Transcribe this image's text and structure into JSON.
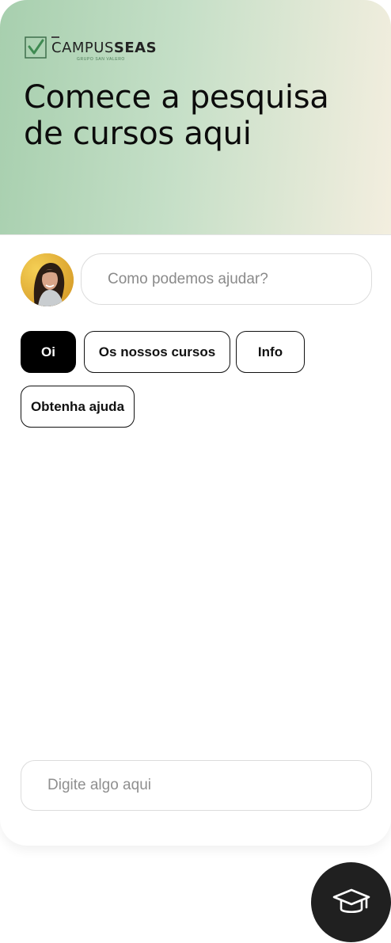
{
  "header": {
    "brand": {
      "light": "CAMPUS",
      "bold": "SEAS",
      "subtitle": "GRUPO SAN VALERO"
    },
    "title": "Comece a pesquisa de cursos aqui",
    "gradient_start": "#a7cfae",
    "gradient_end": "#f3eedf"
  },
  "assistant": {
    "avatar_icon": "agent-avatar",
    "greeting": "Como podemos ajudar?"
  },
  "chips": [
    {
      "label": "Oi",
      "active": true
    },
    {
      "label": "Os nossos cursos",
      "active": false
    },
    {
      "label": "Info",
      "active": false
    },
    {
      "label": "Obtenha ajuda",
      "active": false
    }
  ],
  "composer": {
    "placeholder": "Digite algo aqui"
  },
  "launcher": {
    "icon": "graduation-cap-icon",
    "color": "#202020"
  }
}
